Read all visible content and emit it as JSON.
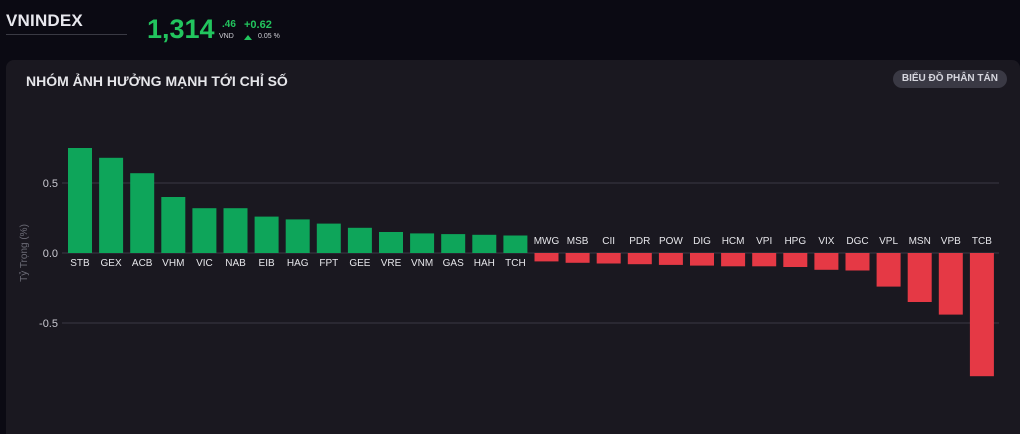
{
  "header": {
    "index_name": "VNINDEX",
    "value_main": "1,314",
    "value_decimal": ".46",
    "currency": "VND",
    "change": "+0.62",
    "change_pct": "0.05 %",
    "color_up": "#22c55e"
  },
  "panel": {
    "title": "NHÓM ẢNH HƯỞNG MẠNH TỚI CHỈ SỐ",
    "scatter_button": "BIỂU ĐỒ PHÂN TÁN"
  },
  "chart_data": {
    "type": "bar",
    "ylabel": "Tỷ Trọng (%)",
    "ylim": [
      -0.85,
      0.85
    ],
    "yticks": [
      0.5,
      0.0,
      -0.5
    ],
    "ytick_labels": [
      "0.5",
      "0.0",
      "-0.5"
    ],
    "grid": true,
    "colors": {
      "positive": "#0ea55a",
      "negative": "#e53945"
    },
    "categories": [
      "STB",
      "GEX",
      "ACB",
      "VHM",
      "VIC",
      "NAB",
      "EIB",
      "HAG",
      "FPT",
      "GEE",
      "VRE",
      "VNM",
      "GAS",
      "HAH",
      "TCH",
      "MWG",
      "MSB",
      "CII",
      "PDR",
      "POW",
      "DIG",
      "HCM",
      "VPI",
      "HPG",
      "VIX",
      "DGC",
      "VPL",
      "MSN",
      "VPB",
      "TCB"
    ],
    "values": [
      0.75,
      0.68,
      0.57,
      0.4,
      0.32,
      0.32,
      0.26,
      0.24,
      0.21,
      0.18,
      0.15,
      0.14,
      0.135,
      0.13,
      0.125,
      -0.06,
      -0.07,
      -0.075,
      -0.08,
      -0.085,
      -0.09,
      -0.095,
      -0.095,
      -0.1,
      -0.12,
      -0.125,
      -0.24,
      -0.35,
      -0.44,
      -0.88
    ]
  }
}
